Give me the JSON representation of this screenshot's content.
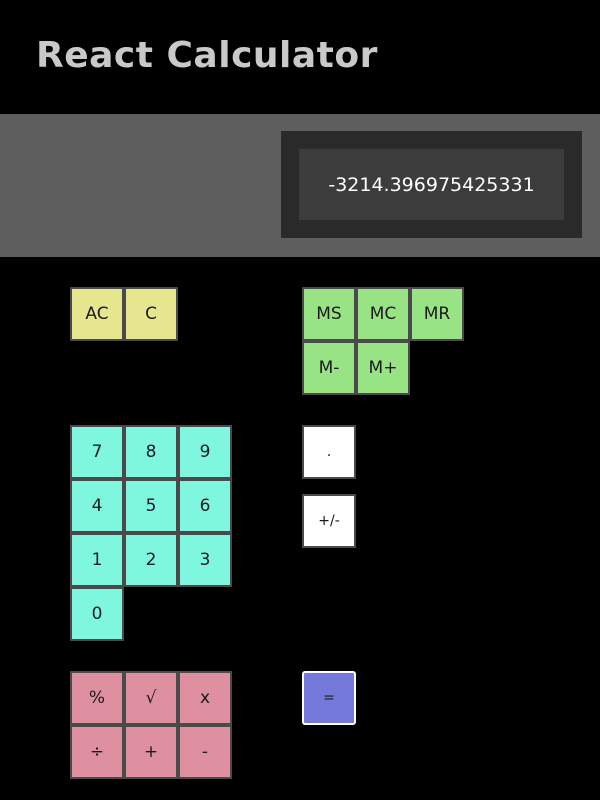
{
  "app": {
    "title": "React Calculator"
  },
  "display": {
    "value": "-3214.396975425331"
  },
  "keys": {
    "clear_all": "AC",
    "clear": "C",
    "memory_store": "MS",
    "memory_clear": "MC",
    "memory_recall": "MR",
    "memory_minus": "M-",
    "memory_plus": "M+",
    "digit_7": "7",
    "digit_8": "8",
    "digit_9": "9",
    "digit_4": "4",
    "digit_5": "5",
    "digit_6": "6",
    "digit_1": "1",
    "digit_2": "2",
    "digit_3": "3",
    "digit_0": "0",
    "decimal": ".",
    "negate": "+/-",
    "percent": "%",
    "sqrt": "√",
    "multiply": "x",
    "divide": "÷",
    "add": "+",
    "subtract": "-",
    "equals": "="
  },
  "colors": {
    "background": "#000000",
    "display_band": "#5e5e5e",
    "clear_keys": "#e6e68e",
    "memory_keys": "#98e484",
    "digit_keys": "#7ff6de",
    "modifier_keys": "#ffffff",
    "operator_keys": "#de8fa0",
    "equals_key": "#7579d9"
  }
}
